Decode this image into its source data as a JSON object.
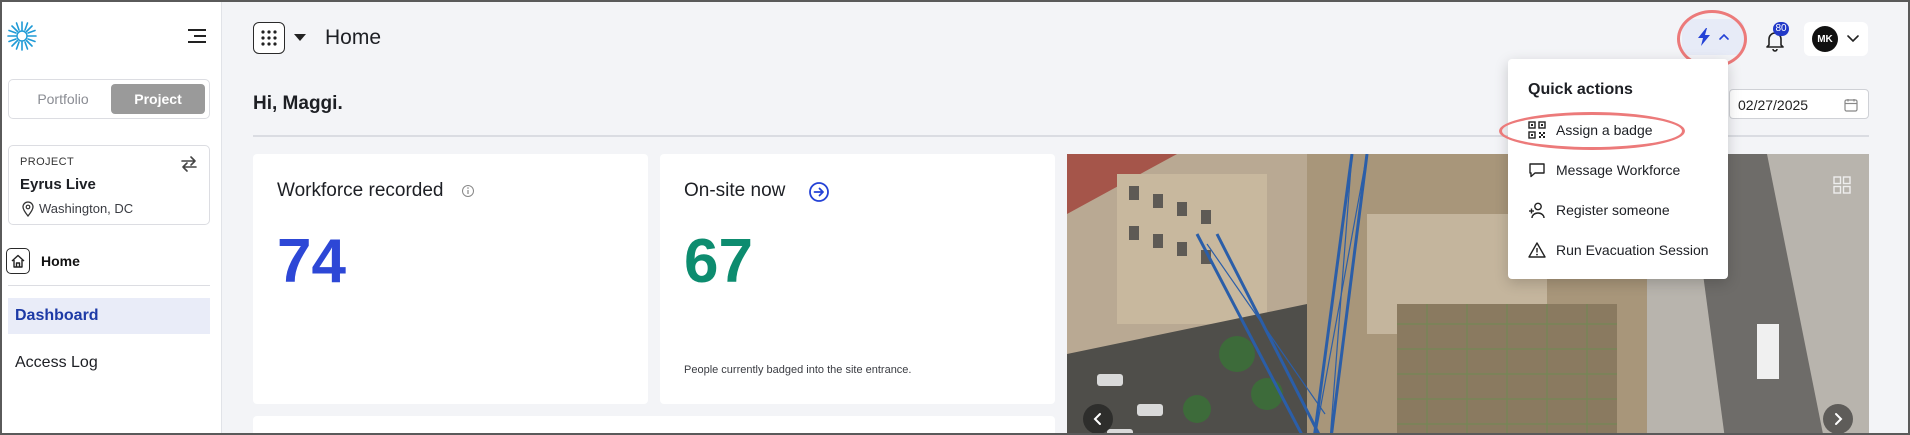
{
  "header": {
    "page_title": "Home",
    "notifications_count": "80",
    "user_initials": "MK"
  },
  "sidebar": {
    "segment": {
      "portfolio": "Portfolio",
      "project": "Project",
      "selected": "Project"
    },
    "project_card": {
      "caption": "PROJECT",
      "name": "Eyrus Live",
      "location": "Washington, DC"
    },
    "home_label": "Home",
    "items": [
      {
        "label": "Dashboard",
        "active": true
      },
      {
        "label": "Access Log",
        "active": false
      }
    ]
  },
  "main": {
    "greeting": "Hi, Maggi.",
    "date_value": "02/27/2025",
    "cards": [
      {
        "title": "Workforce recorded",
        "value": "74",
        "note": ""
      },
      {
        "title": "On-site now",
        "value": "67",
        "note": "People currently badged into the site entrance."
      }
    ]
  },
  "quick_actions": {
    "heading": "Quick actions",
    "items": [
      {
        "label": "Assign a badge",
        "icon": "qr-code-icon"
      },
      {
        "label": "Message Workforce",
        "icon": "chat-bubble-icon"
      },
      {
        "label": "Register someone",
        "icon": "add-person-icon"
      },
      {
        "label": "Run Evacuation Session",
        "icon": "warning-triangle-icon"
      }
    ]
  },
  "colors": {
    "accent_blue": "#2d47d6",
    "accent_green": "#0d8c6f",
    "highlight_ring": "#ec7a7a",
    "nav_active_bg": "#e9ecf8"
  }
}
